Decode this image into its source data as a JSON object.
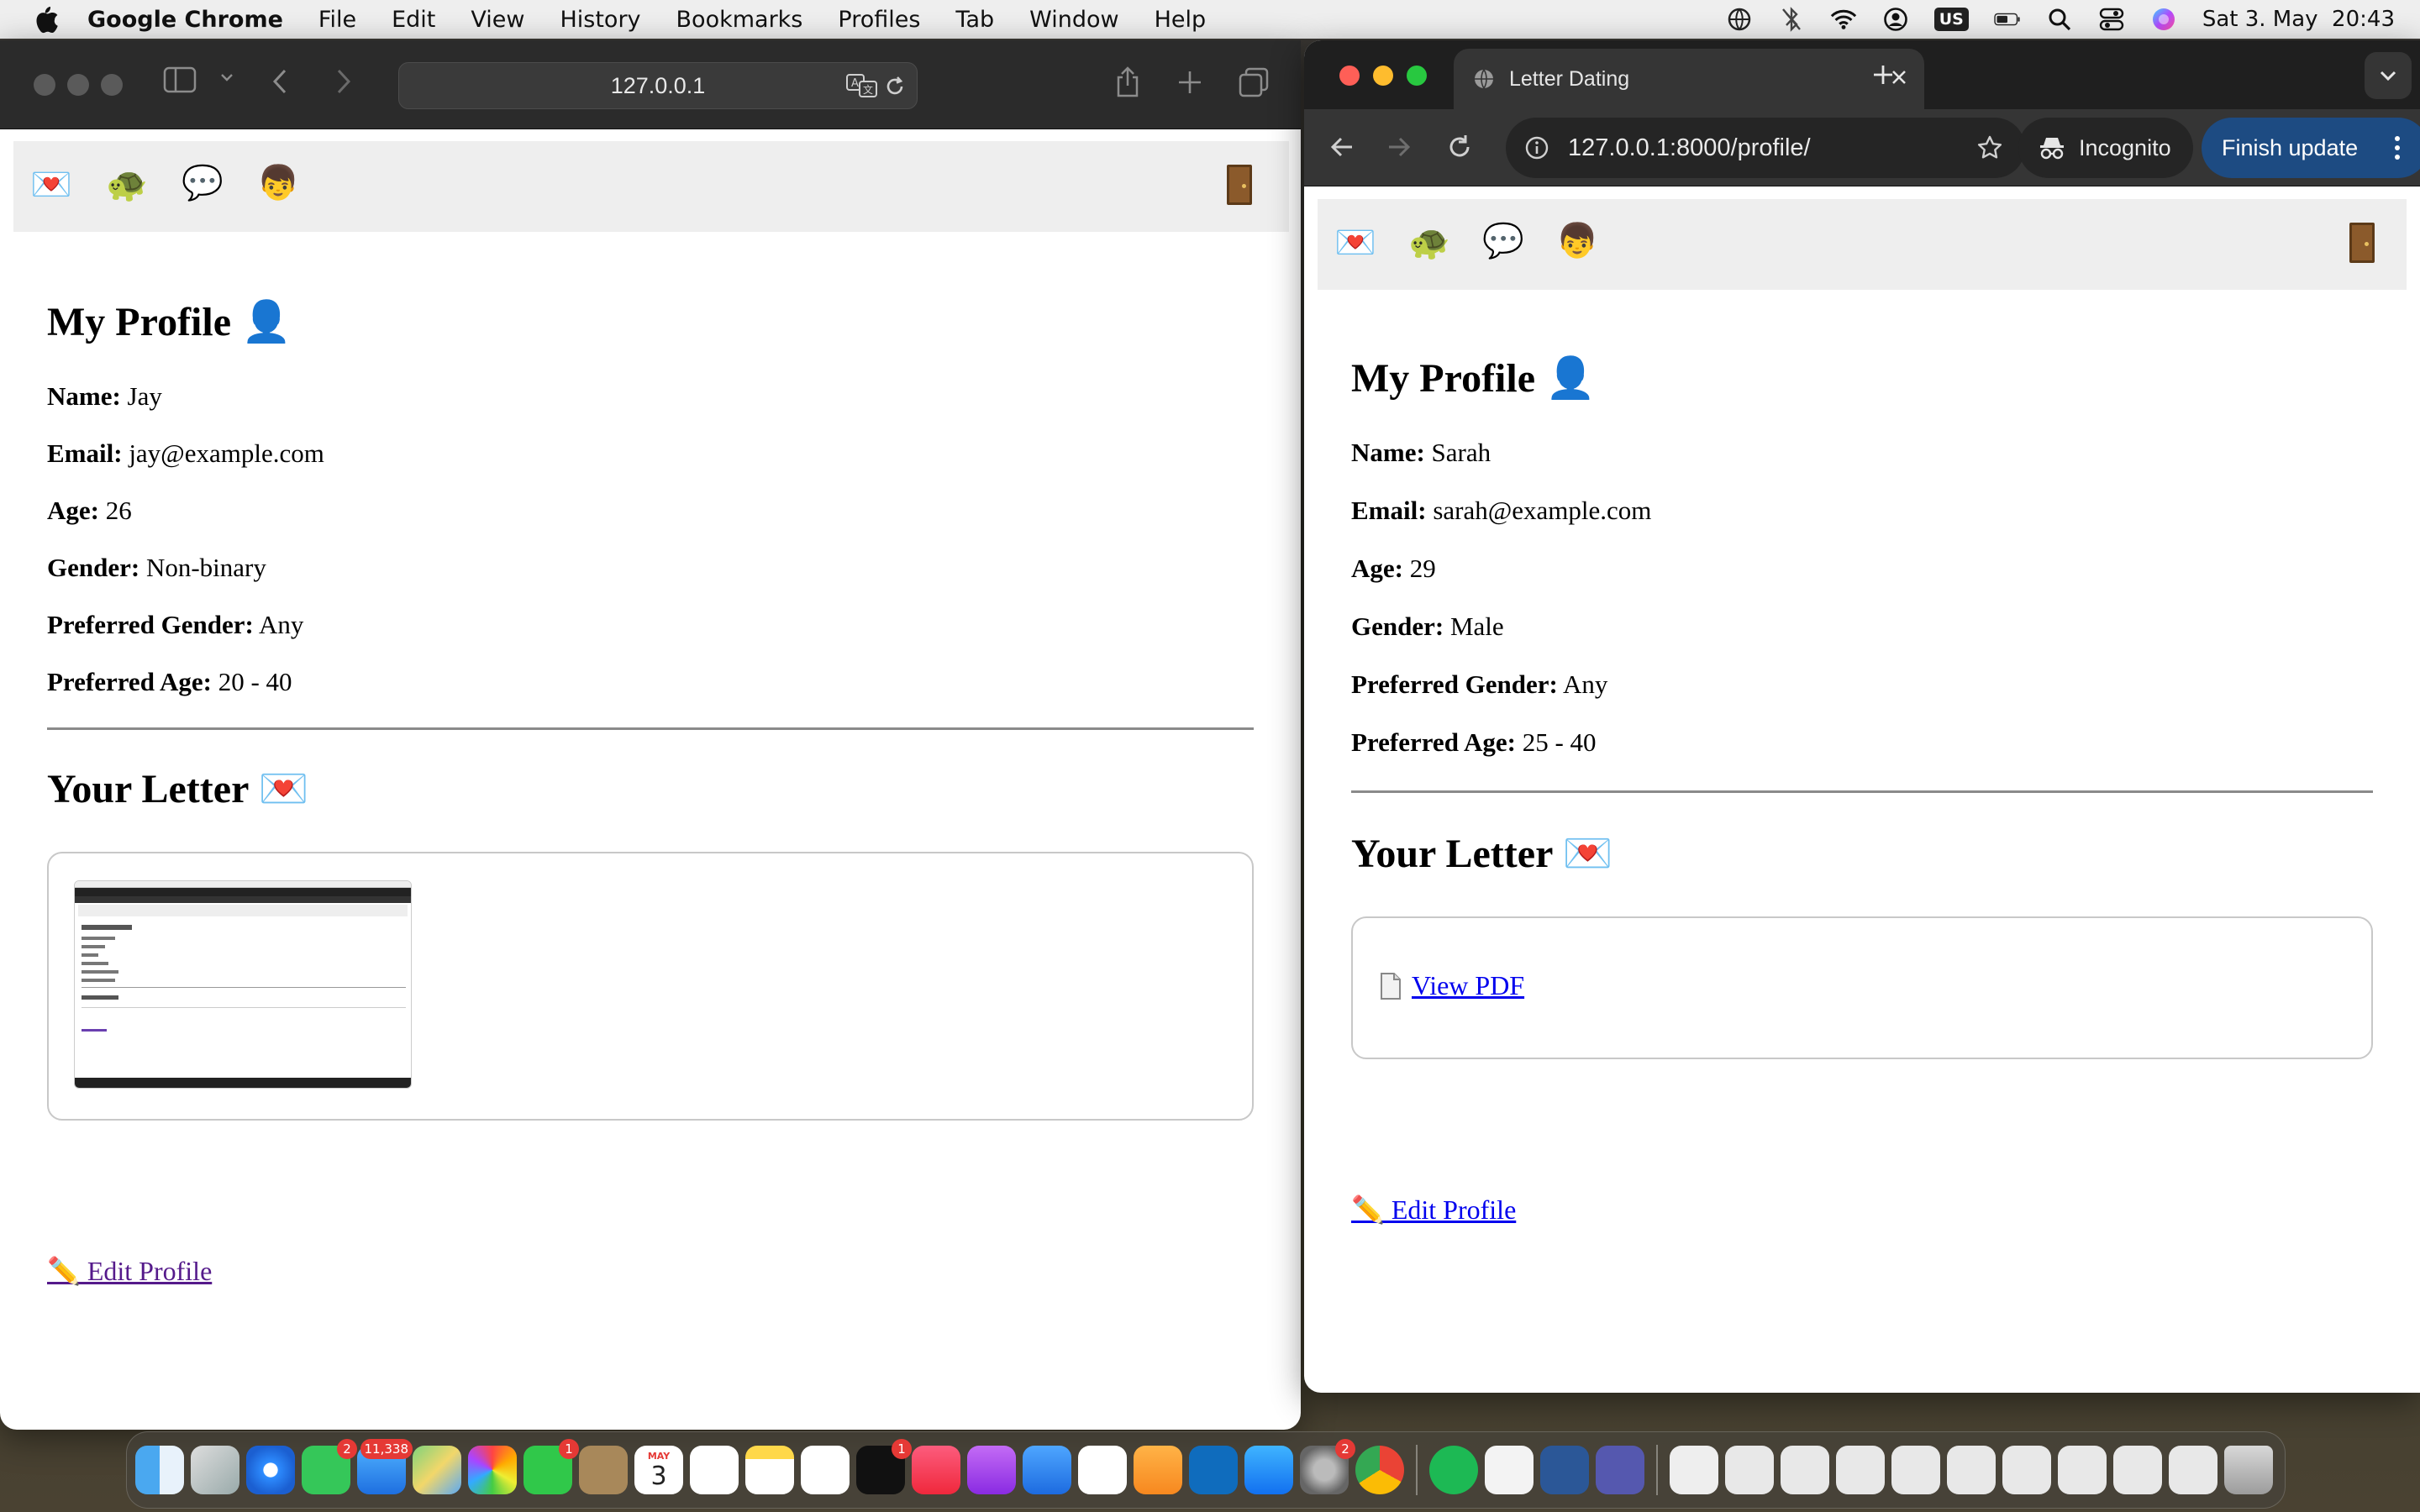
{
  "menubar": {
    "app_name": "Google Chrome",
    "items": [
      "File",
      "Edit",
      "View",
      "History",
      "Bookmarks",
      "Profiles",
      "Tab",
      "Window",
      "Help"
    ],
    "input_badge": "US",
    "datetime": "Sat 3. May  20:43"
  },
  "safari": {
    "address": "127.0.0.1"
  },
  "chrome": {
    "tab_title": "Letter Dating",
    "url": "127.0.0.1:8000/profile/",
    "incognito_label": "Incognito",
    "update_label": "Finish update"
  },
  "left_page": {
    "heading": "My Profile 👤",
    "fields": [
      {
        "label": "Name:",
        "value": "Jay"
      },
      {
        "label": "Email:",
        "value": "jay@example.com"
      },
      {
        "label": "Age:",
        "value": "26"
      },
      {
        "label": "Gender:",
        "value": "Non-binary"
      },
      {
        "label": "Preferred Gender:",
        "value": "Any"
      },
      {
        "label": "Preferred Age:",
        "value": "20 - 40"
      }
    ],
    "letter_heading": "Your Letter 💌",
    "edit_link": "✏️ Edit Profile"
  },
  "right_page": {
    "heading": "My Profile 👤",
    "fields": [
      {
        "label": "Name:",
        "value": "Sarah"
      },
      {
        "label": "Email:",
        "value": "sarah@example.com"
      },
      {
        "label": "Age:",
        "value": "29"
      },
      {
        "label": "Gender:",
        "value": "Male"
      },
      {
        "label": "Preferred Gender:",
        "value": "Any"
      },
      {
        "label": "Preferred Age:",
        "value": "25 - 40"
      }
    ],
    "letter_heading": "Your Letter 💌",
    "pdf_link": "View PDF",
    "edit_link": "✏️ Edit Profile"
  },
  "nav_icons": [
    "letter-heart-icon",
    "turtle-icon",
    "speech-bubble-icon",
    "person-icon",
    "door-icon"
  ],
  "dock": {
    "badges": {
      "messages": "2",
      "mail": "11,338",
      "facetime": "1",
      "tv": "1",
      "settings": "2"
    },
    "calendar_month": "MAY",
    "calendar_day": "3"
  }
}
